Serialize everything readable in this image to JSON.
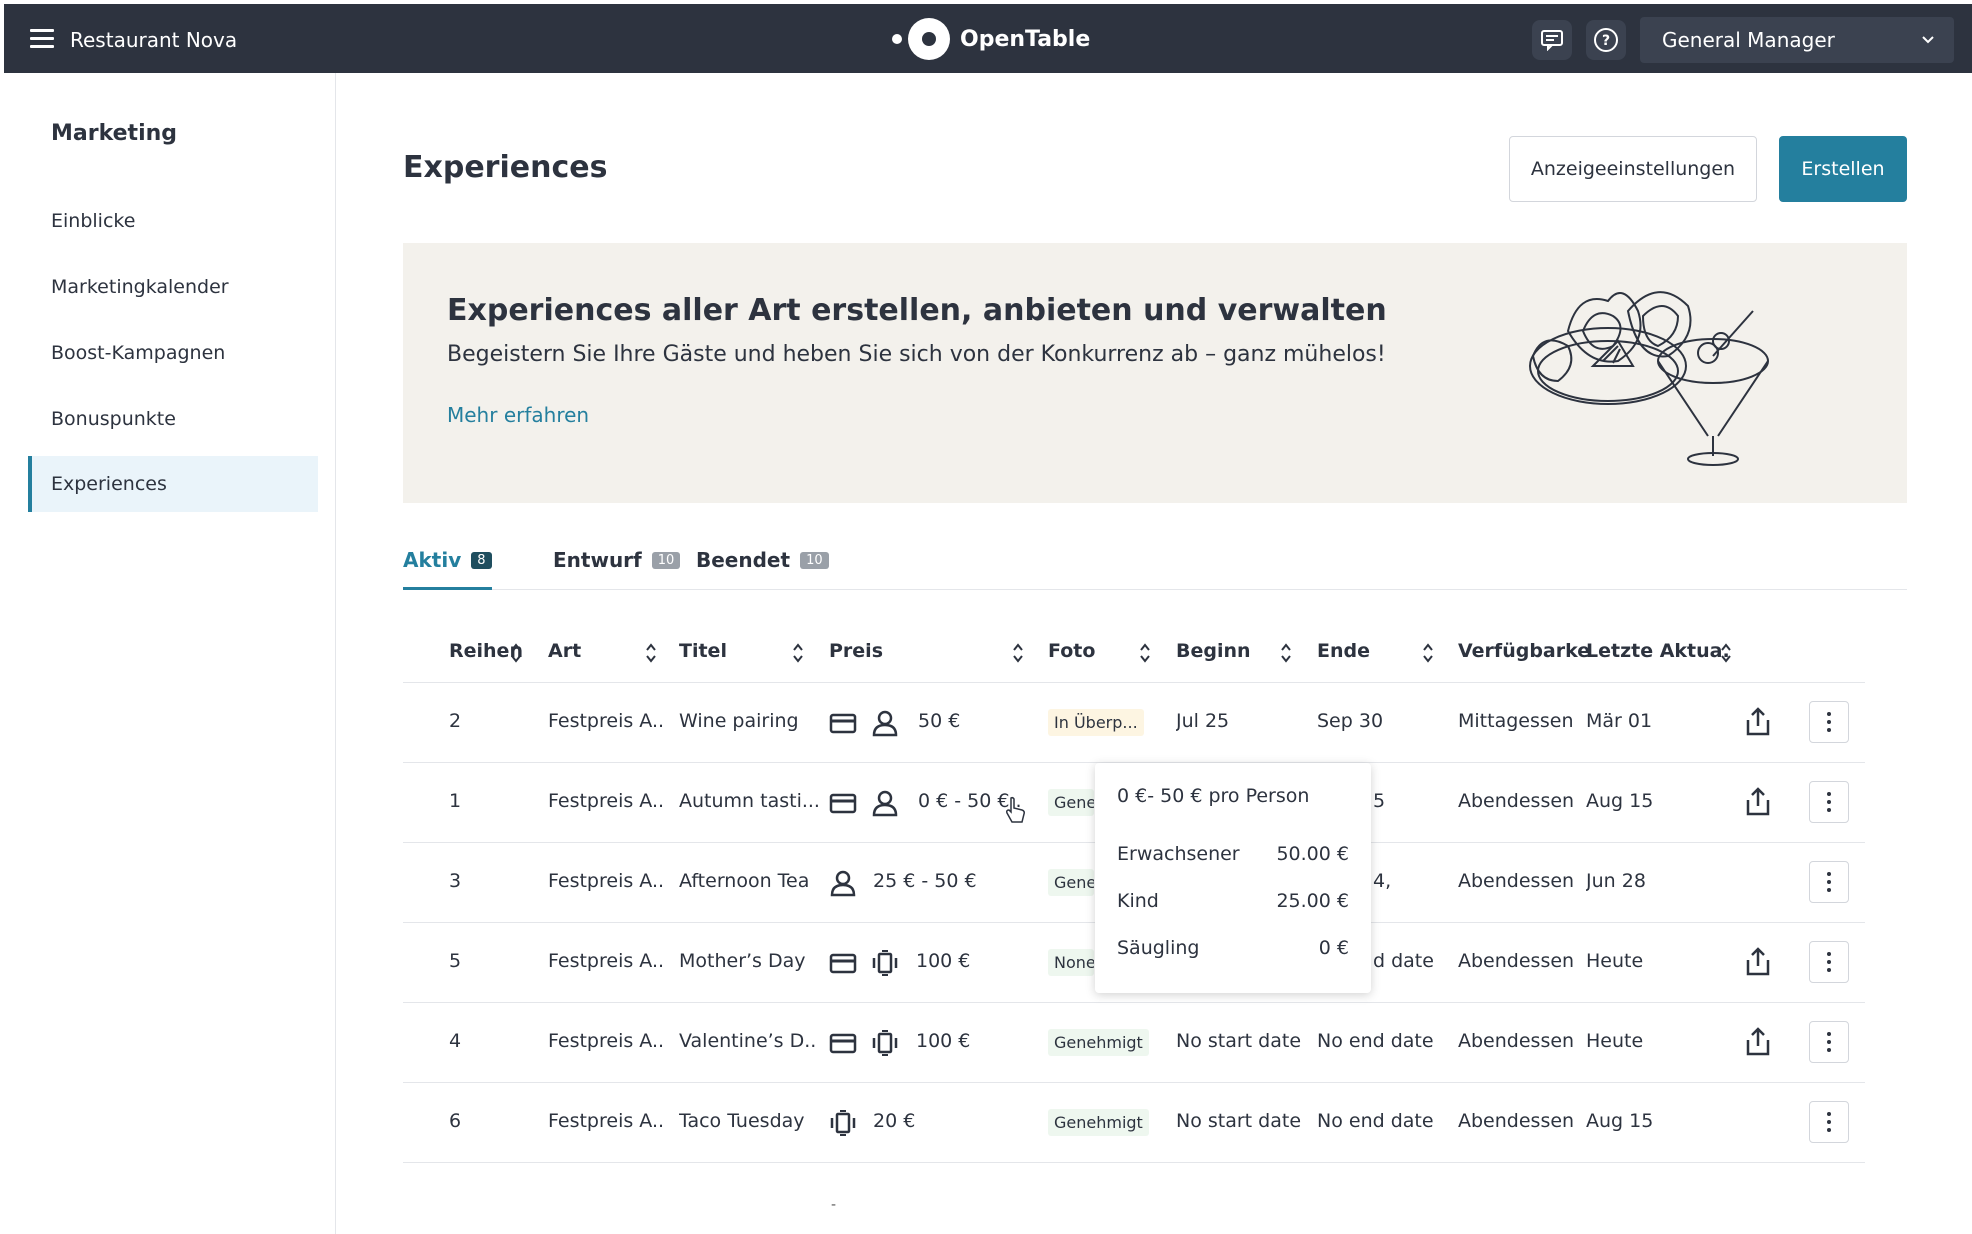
{
  "header": {
    "restaurant_name": "Restaurant Nova",
    "logo_text": "OpenTable",
    "role": "General Manager",
    "icons": [
      "menu-icon",
      "chat-icon",
      "help-icon",
      "chevron-down-icon"
    ]
  },
  "sidebar": {
    "title": "Marketing",
    "items": [
      {
        "label": "Einblicke",
        "active": false
      },
      {
        "label": "Marketingkalender",
        "active": false
      },
      {
        "label": "Boost-Kampagnen",
        "active": false
      },
      {
        "label": "Bonuspunkte",
        "active": false
      },
      {
        "label": "Experiences",
        "active": true
      }
    ]
  },
  "main": {
    "title": "Experiences",
    "buttons": {
      "settings": "Anzeigeeinstellungen",
      "create": "Erstellen"
    }
  },
  "banner": {
    "title": "Experiences aller Art erstellen, anbieten und verwalten",
    "subtitle": "Begeistern Sie Ihre Gäste und heben Sie sich von der Konkurrenz ab – ganz mühelos!",
    "link": "Mehr erfahren"
  },
  "tabs": [
    {
      "label": "Aktiv",
      "count": "8",
      "active": true
    },
    {
      "label": "Entwurf",
      "count": "10",
      "active": false
    },
    {
      "label": "Beendet",
      "count": "10",
      "active": false
    }
  ],
  "table": {
    "columns": [
      "Reihen",
      "Art",
      "Titel",
      "Preis",
      "Foto",
      "Beginn",
      "Ende",
      "Verfügbarke",
      "Letzte Aktua."
    ],
    "rows": [
      {
        "order": "2",
        "type": "Festpreis A..",
        "title": "Wine pairing",
        "price": "50 €",
        "photo": "In Überp...",
        "start": "Jul 25",
        "end": "Sep 30",
        "availability": "Mittagessen",
        "updated": "Mär 01",
        "icons": [
          "card-icon",
          "person-icon"
        ],
        "share": true
      },
      {
        "order": "1",
        "type": "Festpreis A..",
        "title": "Autumn tasti...",
        "price": "0 € - 50 €..",
        "photo": "Gene",
        "start": "",
        "end": "5",
        "availability": "Abendessen",
        "updated": "Aug 15",
        "icons": [
          "card-icon",
          "person-icon"
        ],
        "share": true
      },
      {
        "order": "3",
        "type": "Festpreis A..",
        "title": "Afternoon Tea",
        "price": "25 € - 50 €",
        "photo": "Gene",
        "start": "",
        "end": "4,",
        "availability": "Abendessen",
        "updated": "Jun 28",
        "icons": [
          "person-icon"
        ],
        "share": false
      },
      {
        "order": "5",
        "type": "Festpreis A..",
        "title": "Mother’s Day",
        "price": "100 €",
        "photo": "None",
        "start": "",
        "end": "d date",
        "availability": "Abendessen",
        "updated": "Heute",
        "icons": [
          "card-icon",
          "table-icon"
        ],
        "share": true
      },
      {
        "order": "4",
        "type": "Festpreis A..",
        "title": "Valentine’s D..",
        "price": "100 €",
        "photo": "Genehmigt",
        "start": "No start date",
        "end": "No end date",
        "availability": "Abendessen",
        "updated": "Heute",
        "icons": [
          "card-icon",
          "table-icon"
        ],
        "share": true
      },
      {
        "order": "6",
        "type": "Festpreis A..",
        "title": "Taco Tuesday",
        "price": "20 €",
        "photo": "Genehmigt",
        "start": "No start date",
        "end": "No end date",
        "availability": "Abendessen",
        "updated": "Aug 15",
        "icons": [
          "table-icon"
        ],
        "share": false
      }
    ]
  },
  "tooltip": {
    "header": "0 €- 50 € pro Person",
    "items": [
      {
        "label": "Erwachsener",
        "value": "50.00 €"
      },
      {
        "label": "Kind",
        "value": "25.00 €"
      },
      {
        "label": "Säugling",
        "value": "0 €"
      }
    ]
  },
  "colors": {
    "topbar": "#2d333f",
    "accent": "#247f9e",
    "banner": "#f3f1ec",
    "approved_badge": "#eef7ef",
    "pending_badge": "#fdf5e2"
  }
}
